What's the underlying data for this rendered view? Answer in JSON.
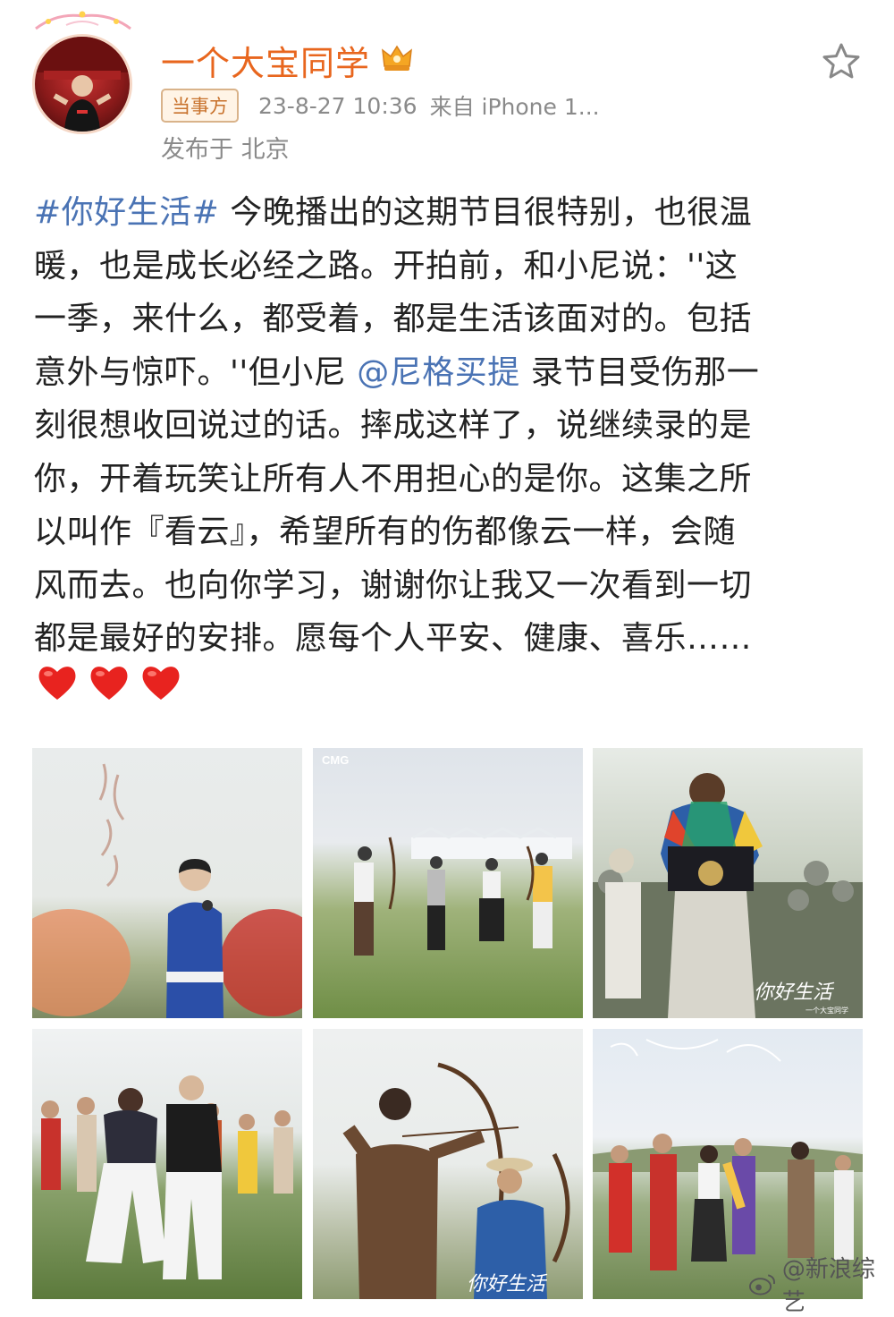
{
  "post": {
    "username": "一个大宝同学",
    "tag": "当事方",
    "time": "23-8-27 10:36",
    "source": "来自 iPhone 1...",
    "location": "发布于 北京"
  },
  "content": {
    "line1_hashtag": "#你好生活#",
    "line1_rest": " 今晚播出的这期节目很特别，也很温",
    "line2": "暖，也是成长必经之路。开拍前，和小尼说：''这",
    "line3": "一季，来什么，都受着，都是生活该面对的。包括",
    "line4_pre": "意外与惊吓。''但小尼 ",
    "line4_mention": "@尼格买提",
    "line4_post": " 录节目受伤那一",
    "line5": "刻很想收回说过的话。摔成这样了，说继续录的是",
    "line6": "你，开着玩笑让所有人不用担心的是你。这集之所",
    "line7": "以叫作『看云』，希望所有的伤都像云一样，会随",
    "line8": "风而去。也向你学习，谢谢你让我又一次看到一切",
    "line9": "都是最好的安排。愿每个人平安、健康、喜乐……"
  },
  "photos": {
    "p2_logo": "CMG",
    "p3_caption": "你好生活",
    "p3_sub": "一个大宝同学",
    "p5_caption": "你好生活"
  },
  "watermark": "@新浪综艺",
  "colors": {
    "username": "#e8661e",
    "link": "#4a73b4",
    "meta": "#8a8a8a",
    "heart": "#e8231f"
  }
}
